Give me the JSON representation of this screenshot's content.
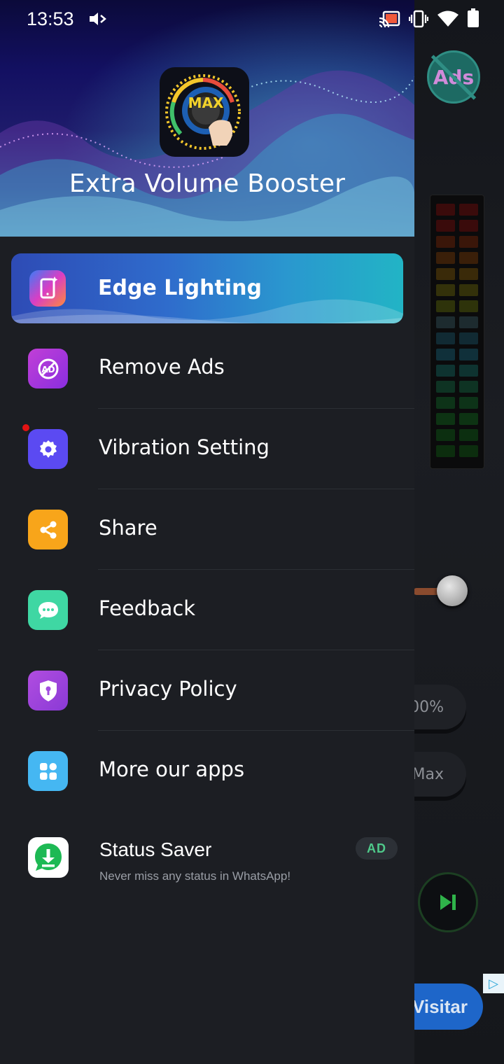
{
  "status_bar": {
    "time": "13:53",
    "icons": [
      "sound-icon",
      "cast-icon",
      "vibrate-icon",
      "wifi-icon",
      "battery-icon"
    ]
  },
  "background_app": {
    "ads_badge": "Ads",
    "percent_button": "00%",
    "max_button": "Max",
    "ad_button": "Visitar"
  },
  "drawer": {
    "header": {
      "app_title": "Extra Volume Booster",
      "logo_text": "MAX"
    },
    "highlight_item": {
      "label": "Edge Lighting",
      "icon": "edge-lighting-icon"
    },
    "items": [
      {
        "label": "Remove Ads",
        "icon": "remove-ads-icon",
        "color": "#c13fd6"
      },
      {
        "label": "Vibration Setting",
        "icon": "gear-icon",
        "color": "#5b4af2",
        "notification_dot": true
      },
      {
        "label": "Share",
        "icon": "share-icon",
        "color": "#f8a51a"
      },
      {
        "label": "Feedback",
        "icon": "chat-icon",
        "color": "#3fd7a3"
      },
      {
        "label": "Privacy Policy",
        "icon": "shield-lock-icon",
        "color": "#a34de0"
      },
      {
        "label": "More our apps",
        "icon": "apps-grid-icon",
        "color": "#45b7f2"
      }
    ],
    "ad_item": {
      "title": "Status Saver",
      "subtitle": "Never miss any status in WhatsApp!",
      "tag": "AD",
      "icon": "download-icon"
    }
  }
}
